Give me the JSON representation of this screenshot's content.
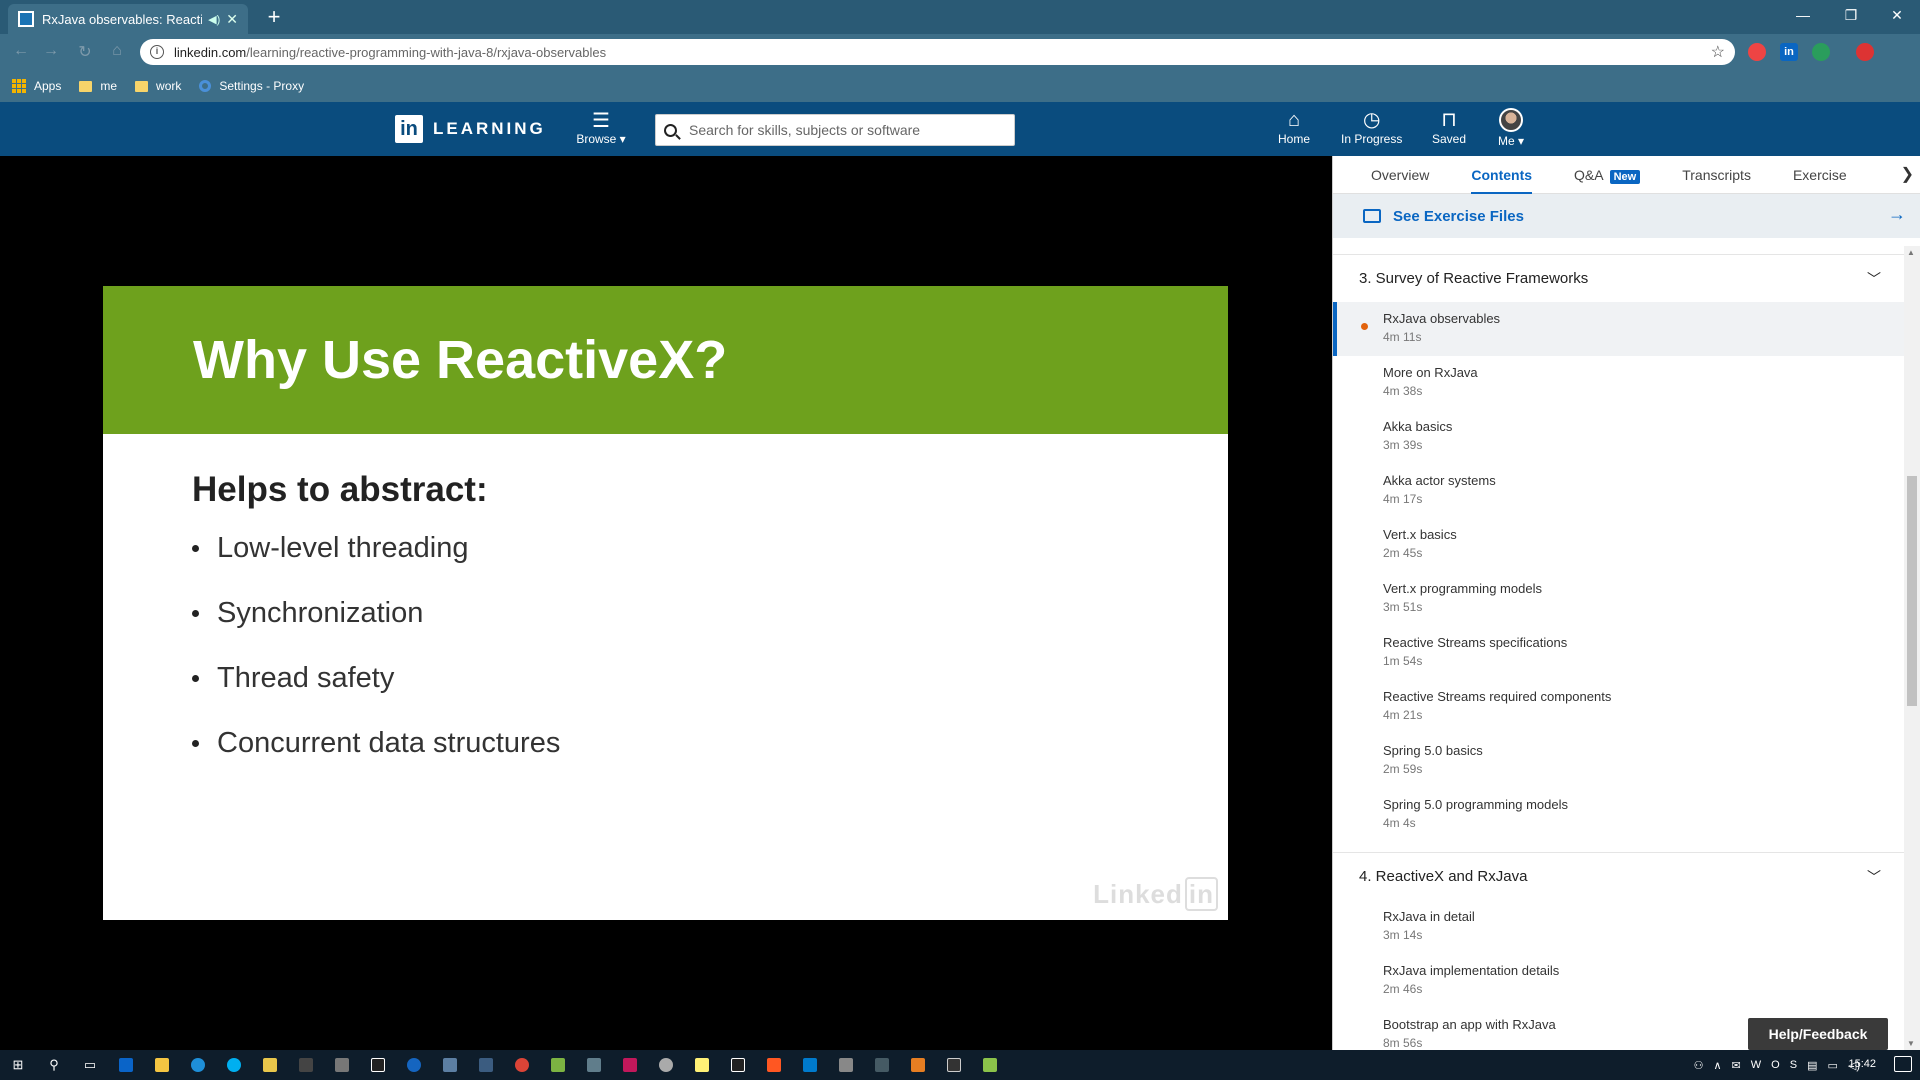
{
  "browser": {
    "tab_title": "RxJava observables: Reactive",
    "url_host": "linkedin.com",
    "url_path": "/learning/reactive-programming-with-java-8/rxjava-observables",
    "bookmarks": [
      "Apps",
      "me",
      "work",
      "Settings - Proxy"
    ]
  },
  "header": {
    "brand": "LEARNING",
    "browse_label": "Browse",
    "search_placeholder": "Search for skills, subjects or software",
    "nav": {
      "home": "Home",
      "in_progress": "In Progress",
      "saved": "Saved",
      "me": "Me"
    }
  },
  "slide": {
    "title": "Why Use ReactiveX?",
    "subtitle": "Helps to abstract:",
    "bullets": [
      "Low-level threading",
      "Synchronization",
      "Thread safety",
      "Concurrent data structures"
    ]
  },
  "sidebar": {
    "tabs": [
      "Overview",
      "Contents",
      "Q&A",
      "Transcripts",
      "Exercise Files"
    ],
    "new_badge": "New",
    "exercise_files_link": "See Exercise Files",
    "sections": [
      {
        "title": "3. Survey of Reactive Frameworks",
        "items": [
          {
            "name": "RxJava observables",
            "duration": "4m 11s"
          },
          {
            "name": "More on RxJava",
            "duration": "4m 38s"
          },
          {
            "name": "Akka basics",
            "duration": "3m 39s"
          },
          {
            "name": "Akka actor systems",
            "duration": "4m 17s"
          },
          {
            "name": "Vert.x basics",
            "duration": "2m 45s"
          },
          {
            "name": "Vert.x programming models",
            "duration": "3m 51s"
          },
          {
            "name": "Reactive Streams specifications",
            "duration": "1m 54s"
          },
          {
            "name": "Reactive Streams required components",
            "duration": "4m 21s"
          },
          {
            "name": "Spring 5.0 basics",
            "duration": "2m 59s"
          },
          {
            "name": "Spring 5.0 programming models",
            "duration": "4m 4s"
          }
        ]
      },
      {
        "title": "4. ReactiveX and RxJava",
        "items": [
          {
            "name": "RxJava in detail",
            "duration": "3m 14s"
          },
          {
            "name": "RxJava implementation details",
            "duration": "2m 46s"
          },
          {
            "name": "Bootstrap an app with RxJava",
            "duration": "8m 56s"
          }
        ]
      }
    ],
    "help_feedback": "Help/Feedback"
  },
  "taskbar": {
    "clock": "15:42"
  },
  "colors": {
    "brand_blue": "#0a4c7e",
    "slide_green": "#6ea11d",
    "accent_blue": "#0a66c2",
    "now_playing": "#e2620b"
  }
}
